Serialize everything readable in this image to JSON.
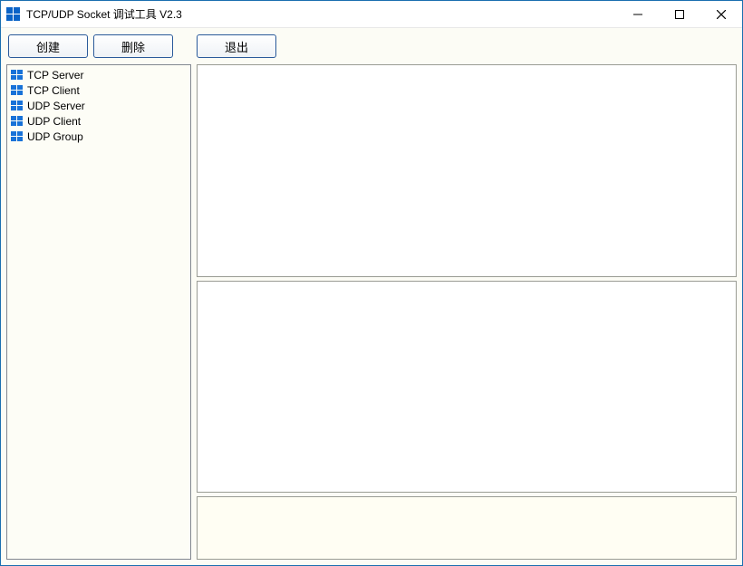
{
  "titlebar": {
    "title": "TCP/UDP Socket 调试工具 V2.3"
  },
  "toolbar": {
    "create_label": "创建",
    "delete_label": "删除",
    "exit_label": "退出"
  },
  "sidebar": {
    "items": [
      {
        "label": "TCP Server"
      },
      {
        "label": "TCP Client"
      },
      {
        "label": "UDP Server"
      },
      {
        "label": "UDP Client"
      },
      {
        "label": "UDP Group"
      }
    ]
  }
}
